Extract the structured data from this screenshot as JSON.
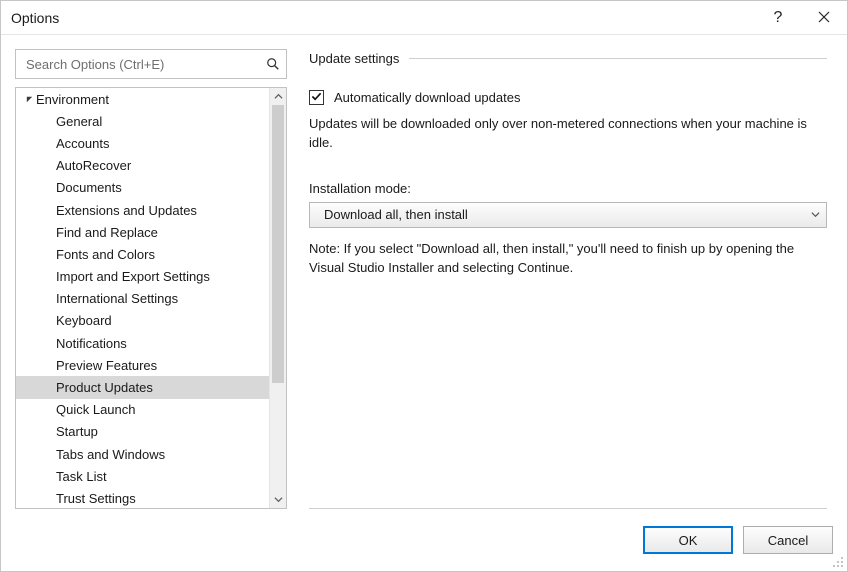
{
  "window": {
    "title": "Options"
  },
  "search": {
    "placeholder": "Search Options (Ctrl+E)"
  },
  "tree": {
    "root": "Environment",
    "selected": "Product Updates",
    "items": [
      "General",
      "Accounts",
      "AutoRecover",
      "Documents",
      "Extensions and Updates",
      "Find and Replace",
      "Fonts and Colors",
      "Import and Export Settings",
      "International Settings",
      "Keyboard",
      "Notifications",
      "Preview Features",
      "Product Updates",
      "Quick Launch",
      "Startup",
      "Tabs and Windows",
      "Task List",
      "Trust Settings"
    ]
  },
  "settings": {
    "section_title": "Update settings",
    "auto_download": {
      "checked": true,
      "label": "Automatically download updates",
      "description": "Updates will be downloaded only over non-metered connections when your machine is idle."
    },
    "install_mode": {
      "label": "Installation mode:",
      "selected": "Download all, then install",
      "note": "Note: If you select \"Download all, then install,\" you'll need to finish up by opening the Visual Studio Installer and selecting Continue."
    }
  },
  "buttons": {
    "ok": "OK",
    "cancel": "Cancel"
  }
}
